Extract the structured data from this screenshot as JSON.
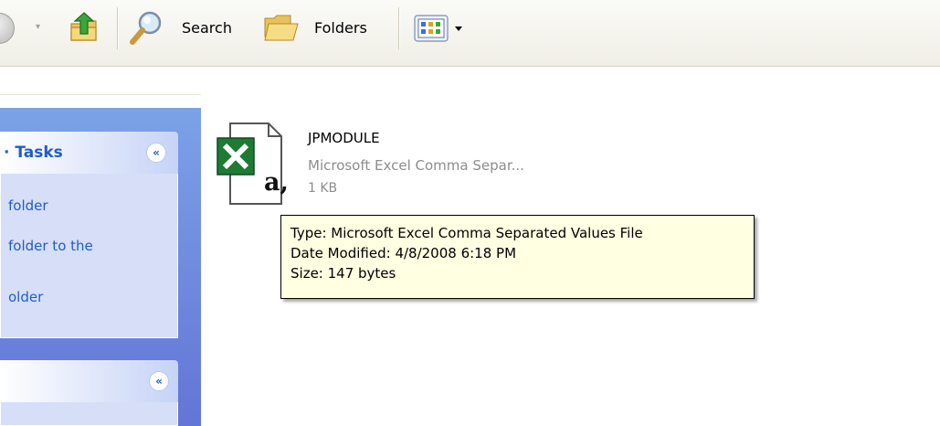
{
  "toolbar": {
    "back_icon": "back-arrow-icon",
    "dropdown_arrow": "▾",
    "up_icon": "up-folder-icon",
    "search_label": "Search",
    "folders_label": "Folders",
    "views_icon": "views-icon",
    "views_arrow": "▾"
  },
  "task_pane": {
    "group1": {
      "title": "· Tasks",
      "collapse_glyph": "«",
      "links": [
        "folder",
        "folder to the",
        "older"
      ]
    },
    "group2": {
      "collapse_glyph": "«"
    }
  },
  "file": {
    "name": "JPMODULE",
    "type": "Microsoft Excel Comma Separ...",
    "size": "1 KB",
    "icon": "excel-csv-file-icon",
    "badge_letter": "a,"
  },
  "tooltip": {
    "type_line": "Type: Microsoft Excel Comma Separated Values File",
    "date_line": "Date Modified: 4/8/2008 6:18 PM",
    "size_line": "Size: 147 bytes"
  },
  "colors": {
    "task_pane_blue": "#6f8ddf",
    "link_blue": "#215dc6",
    "tooltip_bg": "#ffffe1",
    "excel_green": "#1e7b34"
  }
}
